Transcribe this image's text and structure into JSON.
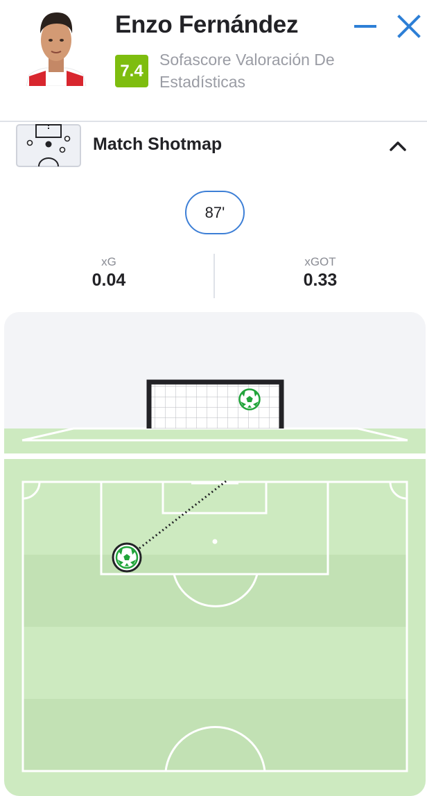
{
  "header": {
    "player_name": "Enzo Fernández",
    "rating": "7.4",
    "rating_label": "Sofascore Valoración De Estadísticas",
    "rating_color": "#7ebd0f"
  },
  "icons": {
    "minimize": "minimize-icon",
    "close": "close-icon",
    "section": "shotmap-pitch-icon",
    "collapse": "chevron-up-icon",
    "shot": "football-icon"
  },
  "section": {
    "title": "Match Shotmap"
  },
  "shot": {
    "minute": "87'",
    "xg_label": "xG",
    "xg_value": "0.04",
    "xgot_label": "xGOT",
    "xgot_value": "0.33"
  },
  "colors": {
    "accent": "#3d7fd6",
    "pitch": "#cdeac0",
    "pitch_stripe": "#c2e1b4",
    "shot_marker": "#21a43a"
  }
}
